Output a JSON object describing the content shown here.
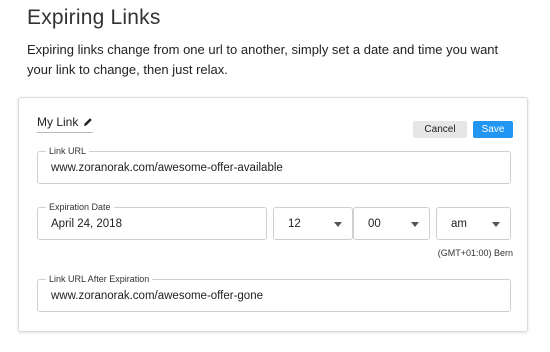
{
  "page": {
    "title": "Expiring Links",
    "description": "Expiring links change from one url to another, simply set a date and time you want your link to change, then just relax."
  },
  "card": {
    "link_name": "My Link",
    "cancel_label": "Cancel",
    "save_label": "Save",
    "link_url": {
      "label": "Link URL",
      "value": "www.zoranorak.com/awesome-offer-available"
    },
    "expiration_date": {
      "label": "Expiration Date",
      "value": "April 24, 2018"
    },
    "hour": {
      "value": "12"
    },
    "minute": {
      "value": "00"
    },
    "ampm": {
      "value": "am"
    },
    "timezone": "(GMT+01:00) Bern",
    "link_url_after": {
      "label": "Link URL After Expiration",
      "value": "www.zoranorak.com/awesome-offer-gone"
    }
  },
  "colors": {
    "save_button": "#2196f3",
    "cancel_button": "#e6e6e6",
    "border": "#cfcfcf"
  },
  "icons": {
    "edit": "pencil-icon",
    "dropdown": "chevron-down-icon"
  }
}
